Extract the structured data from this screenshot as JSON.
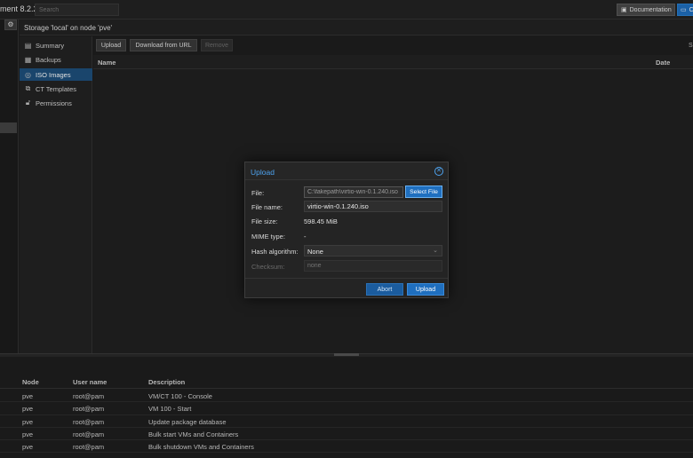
{
  "app": {
    "title": "ment 8.2.2",
    "search_placeholder": "Search",
    "documentation_label": "Documentation",
    "create_label": "Cr"
  },
  "content": {
    "header": "Storage 'local' on node 'pve'"
  },
  "nav": {
    "items": [
      {
        "label": "Summary",
        "icon": "summary-icon"
      },
      {
        "label": "Backups",
        "icon": "backup-icon"
      },
      {
        "label": "ISO Images",
        "icon": "iso-disc-icon",
        "active": true
      },
      {
        "label": "CT Templates",
        "icon": "ct-template-icon"
      },
      {
        "label": "Permissions",
        "icon": "unlock-icon"
      }
    ]
  },
  "toolbar": {
    "upload_label": "Upload",
    "download_label": "Download from URL",
    "remove_label": "Remove",
    "right_label": "S"
  },
  "grid": {
    "col_name": "Name",
    "col_date": "Date"
  },
  "tasks": {
    "columns": [
      "Node",
      "User name",
      "Description"
    ],
    "rows": [
      {
        "node": "pve",
        "user": "root@pam",
        "desc": "VM/CT 100 - Console"
      },
      {
        "node": "pve",
        "user": "root@pam",
        "desc": "VM 100 - Start"
      },
      {
        "node": "pve",
        "user": "root@pam",
        "desc": "Update package database"
      },
      {
        "node": "pve",
        "user": "root@pam",
        "desc": "Bulk start VMs and Containers"
      },
      {
        "node": "pve",
        "user": "root@pam",
        "desc": "Bulk shutdown VMs and Containers"
      }
    ]
  },
  "dialog": {
    "title": "Upload",
    "file_label": "File:",
    "file_value": "C:\\fakepath\\virtio-win-0.1.240.iso",
    "select_file_label": "Select File",
    "filename_label": "File name:",
    "filename_value": "virtio-win-0.1.240.iso",
    "filesize_label": "File size:",
    "filesize_value": "598.45 MiB",
    "mime_label": "MIME type:",
    "mime_value": "-",
    "hash_label": "Hash algorithm:",
    "hash_value": "None",
    "checksum_label": "Checksum:",
    "checksum_placeholder": "none",
    "abort_label": "Abort",
    "upload_label": "Upload"
  },
  "colors": {
    "accent": "#1f6fbf",
    "title_blue": "#4ea3ef",
    "nav_active": "#1e4f7c"
  }
}
